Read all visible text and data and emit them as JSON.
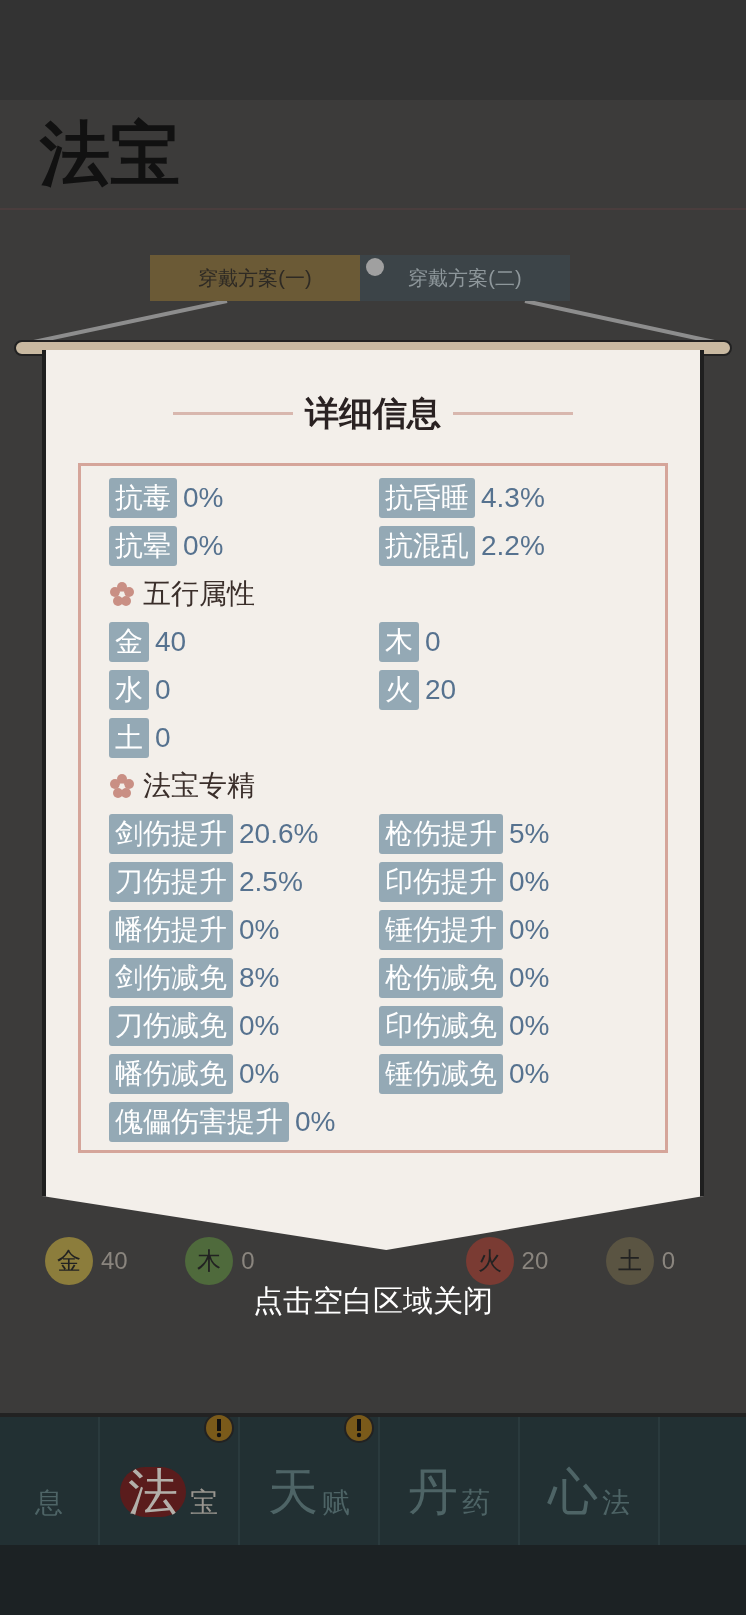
{
  "background": {
    "title": "法宝",
    "plans": [
      {
        "label": "穿戴方案(一)",
        "selected": true
      },
      {
        "label": "穿戴方案(二)",
        "selected": false
      }
    ],
    "elements": [
      {
        "glyph": "金",
        "value": "40",
        "color": "#8c7d3c"
      },
      {
        "glyph": "木",
        "value": "0",
        "color": "#4f6a3c"
      },
      {
        "glyph": "火",
        "value": "20",
        "color": "#7a3b33"
      },
      {
        "glyph": "土",
        "value": "0",
        "color": "#5a5442"
      }
    ]
  },
  "nav": [
    {
      "sub": "息",
      "selected": false,
      "alert": false
    },
    {
      "main": "法",
      "sub": "宝",
      "selected": true,
      "alert": true
    },
    {
      "main": "天",
      "sub": "赋",
      "selected": false,
      "alert": true
    },
    {
      "main": "丹",
      "sub": "药",
      "selected": false,
      "alert": false
    },
    {
      "main": "心",
      "sub": "法",
      "selected": false,
      "alert": false
    }
  ],
  "dialog": {
    "title": "详细信息",
    "sections": [
      {
        "stats": [
          {
            "label": "抗毒",
            "value": "0%"
          },
          {
            "label": "抗昏睡",
            "value": "4.3%"
          },
          {
            "label": "抗晕",
            "value": "0%"
          },
          {
            "label": "抗混乱",
            "value": "2.2%"
          }
        ]
      },
      {
        "heading": "五行属性",
        "stats": [
          {
            "label": "金",
            "value": "40"
          },
          {
            "label": "木",
            "value": "0"
          },
          {
            "label": "水",
            "value": "0"
          },
          {
            "label": "火",
            "value": "20"
          },
          {
            "label": "土",
            "value": "0"
          }
        ]
      },
      {
        "heading": "法宝专精",
        "stats": [
          {
            "label": "剑伤提升",
            "value": "20.6%"
          },
          {
            "label": "枪伤提升",
            "value": "5%"
          },
          {
            "label": "刀伤提升",
            "value": "2.5%"
          },
          {
            "label": "印伤提升",
            "value": "0%"
          },
          {
            "label": "幡伤提升",
            "value": "0%"
          },
          {
            "label": "锤伤提升",
            "value": "0%"
          },
          {
            "label": "剑伤减免",
            "value": "8%"
          },
          {
            "label": "枪伤减免",
            "value": "0%"
          },
          {
            "label": "刀伤减免",
            "value": "0%"
          },
          {
            "label": "印伤减免",
            "value": "0%"
          },
          {
            "label": "幡伤减免",
            "value": "0%"
          },
          {
            "label": "锤伤减免",
            "value": "0%"
          },
          {
            "label": "傀儡伤害提升",
            "value": "0%"
          }
        ]
      }
    ],
    "close_hint": "点击空白区域关闭"
  }
}
